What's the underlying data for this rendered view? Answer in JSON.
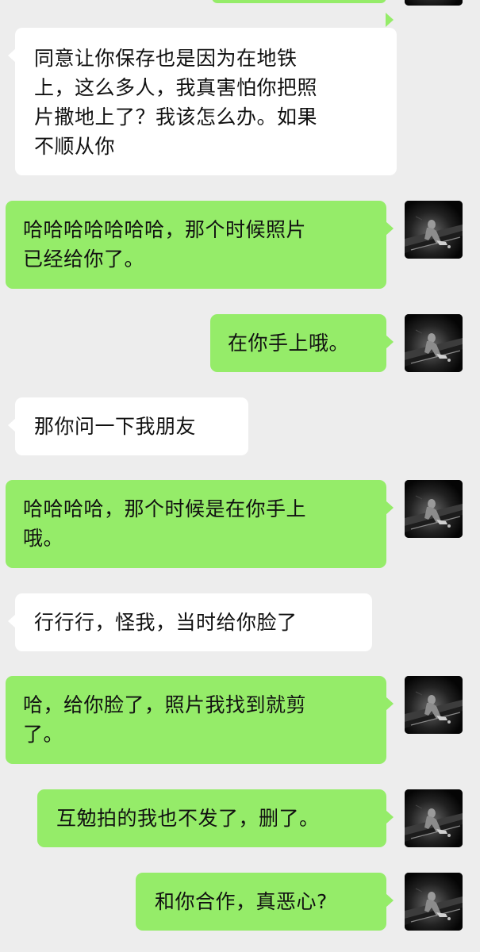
{
  "conversation": {
    "messages": [
      {
        "side": "incoming",
        "text": "同意让你保存也是因为在地铁上，这么多人，我真害怕你把照片撒地上了？我该怎么办。如果不顺从你"
      },
      {
        "side": "outgoing",
        "text": "哈哈哈哈哈哈哈，那个时候照片已经给你了。"
      },
      {
        "side": "outgoing",
        "text": "在你手上哦。"
      },
      {
        "side": "incoming",
        "text": "那你问一下我朋友"
      },
      {
        "side": "outgoing",
        "text": "哈哈哈哈，那个时候是在你手上哦。"
      },
      {
        "side": "incoming",
        "text": "行行行，怪我，当时给你脸了"
      },
      {
        "side": "outgoing",
        "text": "哈，给你脸了，照片我找到就剪了。"
      },
      {
        "side": "outgoing",
        "text": "互勉拍的我也不发了，删了。"
      },
      {
        "side": "outgoing",
        "text": "和你合作，真恶心?"
      }
    ]
  },
  "lines": {
    "m0": [
      "同意让你保存也是因为在地铁",
      "上，这么多人，我真害怕你把照",
      "片撒地上了？我该怎么办。如果",
      "不顺从你"
    ],
    "m1": [
      "哈哈哈哈哈哈哈，那个时候照片",
      "已经给你了。"
    ],
    "m4": [
      "哈哈哈哈，那个时候是在你手上",
      "哦。"
    ],
    "m6": [
      "哈，给你脸了，照片我找到就剪",
      "了。"
    ]
  },
  "colors": {
    "background": "#ededed",
    "incoming_bubble": "#ffffff",
    "outgoing_bubble": "#95ec69",
    "text": "#111111"
  },
  "icons": {
    "self_avatar": "dark-photo-avatar"
  }
}
